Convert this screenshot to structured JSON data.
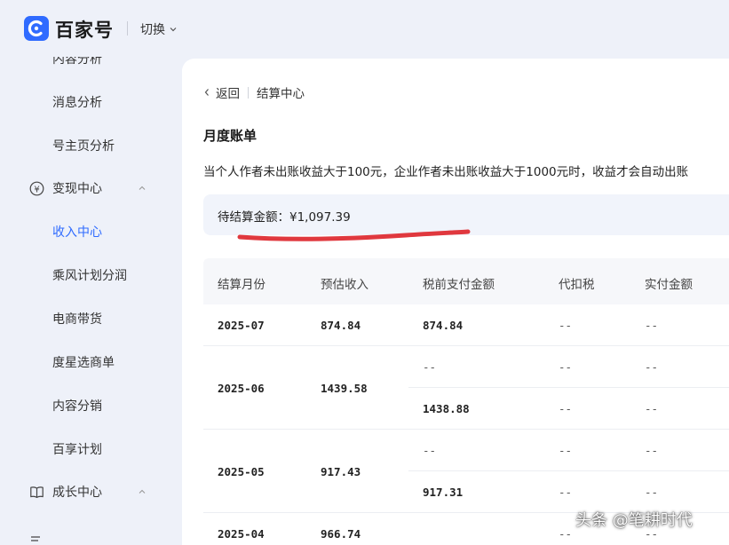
{
  "header": {
    "logo_text": "百家号",
    "switch_label": "切换"
  },
  "sidebar": {
    "items": [
      {
        "label": "内容分析"
      },
      {
        "label": "消息分析"
      },
      {
        "label": "号主页分析"
      },
      {
        "label": "收入中心",
        "active": true
      },
      {
        "label": "乘风计划分润"
      },
      {
        "label": "电商带货"
      },
      {
        "label": "度星选商单"
      },
      {
        "label": "内容分销"
      },
      {
        "label": "百享计划"
      }
    ],
    "groups": [
      {
        "label": "变现中心",
        "icon": "yen-circle-icon"
      },
      {
        "label": "成长中心",
        "icon": "book-icon"
      }
    ]
  },
  "breadcrumb": {
    "back_label": "返回",
    "current": "结算中心"
  },
  "main": {
    "section_title": "月度账单",
    "notice": "当个人作者未出账收益大于100元，企业作者未出账收益大于1000元时，收益才会自动出账",
    "pending_label": "待结算金额：¥1,097.39"
  },
  "table": {
    "columns": [
      "结算月份",
      "预估收入",
      "税前支付金额",
      "代扣税",
      "实付金额"
    ],
    "rows": [
      {
        "month": "2025-07",
        "estimate": "874.84",
        "payments": [
          {
            "pretax": "874.84",
            "tax": "--",
            "paid": "--"
          }
        ]
      },
      {
        "month": "2025-06",
        "estimate": "1439.58",
        "payments": [
          {
            "pretax": "--",
            "tax": "--",
            "paid": "--"
          },
          {
            "pretax": "1438.88",
            "tax": "--",
            "paid": "--"
          }
        ]
      },
      {
        "month": "2025-05",
        "estimate": "917.43",
        "payments": [
          {
            "pretax": "--",
            "tax": "--",
            "paid": "--"
          },
          {
            "pretax": "917.31",
            "tax": "--",
            "paid": "--"
          }
        ]
      },
      {
        "month": "2025-04",
        "estimate": "966.74",
        "payments": [
          {
            "pretax": "",
            "tax": "--",
            "paid": "--"
          }
        ]
      }
    ]
  },
  "watermark": "头条 @笔耕时代",
  "colors": {
    "accent": "#2f6bff",
    "underline": "#e0383e",
    "background": "#eef1f9"
  }
}
